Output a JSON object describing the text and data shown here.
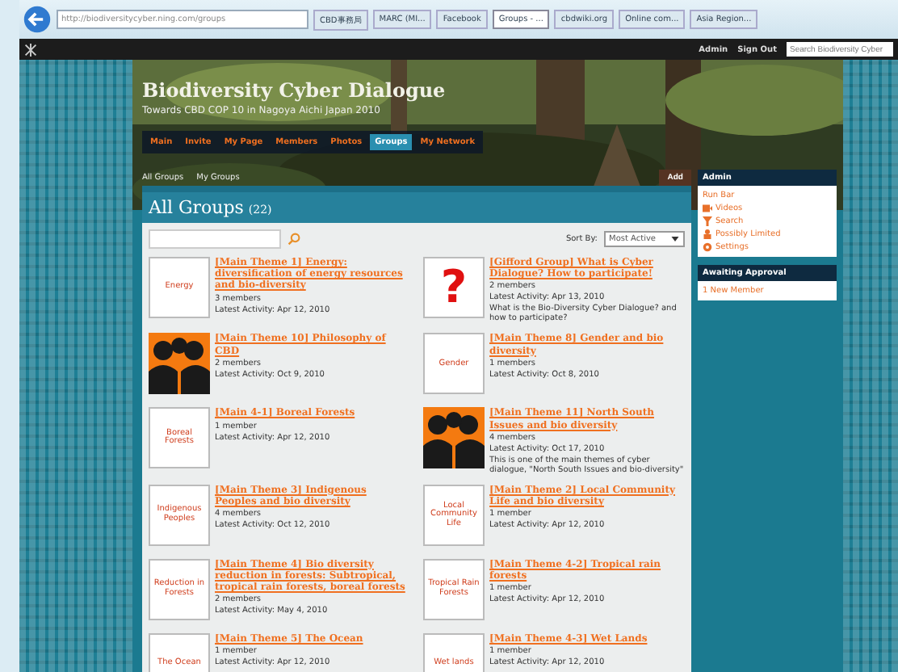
{
  "browser": {
    "address": "http://biodiversitycyber.ning.com/groups",
    "tabs": [
      {
        "label": "CBD事務局",
        "selected": false
      },
      {
        "label": "MARC (MI...",
        "selected": false
      },
      {
        "label": "Facebook",
        "selected": false
      },
      {
        "label": "Groups - ...",
        "selected": true
      },
      {
        "label": "cbdwiki.org",
        "selected": false
      },
      {
        "label": "Online com...",
        "selected": false
      },
      {
        "label": "Asia Region...",
        "selected": false
      }
    ]
  },
  "topbar": {
    "links": [
      "Admin",
      "Sign Out"
    ],
    "search": {
      "placeholder": "Search Biodiversity Cyber"
    }
  },
  "site": {
    "title": "Biodiversity Cyber Dialogue",
    "subtitle": "Towards CBD COP 10 in Nagoya Aichi Japan 2010"
  },
  "nav": [
    {
      "label": "Main",
      "selected": false
    },
    {
      "label": "Invite",
      "selected": false
    },
    {
      "label": "My Page",
      "selected": false
    },
    {
      "label": "Members",
      "selected": false
    },
    {
      "label": "Photos",
      "selected": false
    },
    {
      "label": "Groups",
      "selected": true
    },
    {
      "label": "My Network",
      "selected": false
    }
  ],
  "subnav": [
    "All Groups",
    "My Groups"
  ],
  "add_button": "Add",
  "heading": {
    "title": "All Groups",
    "count": "(22)"
  },
  "sort": {
    "label": "Sort By:",
    "value": "Most Active"
  },
  "groups": [
    {
      "title": "[Main Theme 1] Energy: diversification of energy resources and bio-diversity",
      "members": "3 members",
      "activity": "Latest Activity: Apr 12, 2010",
      "thumb": {
        "kind": "theme",
        "name": "Energy"
      }
    },
    {
      "title": "[Gifford Group] What is Cyber Dialogue? How to participate!",
      "members": "2 members",
      "activity": "Latest Activity: Apr 13, 2010",
      "description": "What is the Bio-Diversity Cyber Dialogue? and how to participate?",
      "thumb": {
        "kind": "question",
        "mark": "?"
      }
    },
    {
      "title": "[Main Theme 10] Philosophy of CBD",
      "members": "2 members",
      "activity": "Latest Activity: Oct 9, 2010",
      "thumb": {
        "kind": "people"
      }
    },
    {
      "title": "[Main Theme 8] Gender and bio diversity",
      "members": "1 members",
      "activity": "Latest Activity: Oct 8, 2010",
      "thumb": {
        "kind": "theme",
        "name": "Gender"
      }
    },
    {
      "title": "[Main 4-1] Boreal Forests",
      "members": "1 member",
      "activity": "Latest Activity: Apr 12, 2010",
      "thumb": {
        "kind": "theme",
        "name": "Boreal Forests"
      }
    },
    {
      "title": "[Main Theme 11] North South Issues and bio diversity",
      "members": "4 members",
      "activity": "Latest Activity: Oct 17, 2010",
      "description": "This is one of the main themes of cyber dialogue, \"North South Issues and bio-diversity\"",
      "thumb": {
        "kind": "people"
      }
    },
    {
      "title": "[Main Theme 3] Indigenous Peoples and bio diversity",
      "members": "4 members",
      "activity": "Latest Activity: Oct 12, 2010",
      "thumb": {
        "kind": "theme",
        "name": "Indigenous Peoples"
      }
    },
    {
      "title": "[Main Theme 2] Local Community Life and bio diversity",
      "members": "1 member",
      "activity": "Latest Activity: Apr 12, 2010",
      "thumb": {
        "kind": "theme",
        "name": "Local Community Life"
      }
    },
    {
      "title": "[Main Theme 4] Bio diversity reduction in forests: Subtropical, tropical rain forests, boreal forests",
      "members": "2 members",
      "activity": "Latest Activity: May 4, 2010",
      "thumb": {
        "kind": "theme",
        "name": "Reduction in Forests"
      }
    },
    {
      "title": "[Main Theme 4-2] Tropical rain forests",
      "members": "1 member",
      "activity": "Latest Activity: Apr 12, 2010",
      "thumb": {
        "kind": "theme",
        "name": "Tropical Rain Forests"
      }
    },
    {
      "title": "[Main Theme 5] The Ocean",
      "members": "1 member",
      "activity": "Latest Activity: Apr 12, 2010",
      "thumb": {
        "kind": "theme",
        "name": "The Ocean"
      }
    },
    {
      "title": "[Main Theme 4-3] Wet Lands",
      "members": "1 member",
      "activity": "Latest Activity: Apr 12, 2010",
      "thumb": {
        "kind": "theme",
        "name": "Wet lands"
      }
    }
  ],
  "sidebar": [
    {
      "title": "Admin",
      "items": [
        {
          "label": "Run Bar",
          "kind": "plain"
        },
        {
          "label": "Videos",
          "kind": "video"
        },
        {
          "label": "Search",
          "kind": "search"
        },
        {
          "label": "Possibly Limited",
          "kind": "person"
        },
        {
          "label": "Settings",
          "kind": "gear"
        }
      ]
    },
    {
      "title": "Awaiting Approval",
      "items": [
        {
          "label": "1 New Member",
          "kind": "plain"
        }
      ]
    }
  ]
}
